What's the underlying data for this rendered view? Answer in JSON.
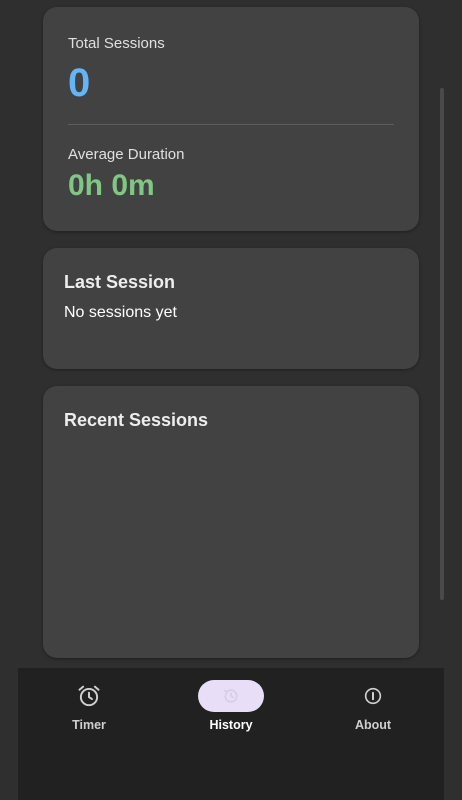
{
  "stats": {
    "total_label": "Total Sessions",
    "total_value": "0",
    "average_label": "Average Duration",
    "average_value": "0h 0m"
  },
  "last_session": {
    "title": "Last Session",
    "text": "No sessions yet"
  },
  "recent_sessions": {
    "title": "Recent Sessions"
  },
  "nav": {
    "items": [
      {
        "label": "Timer",
        "icon": "alarm-clock-icon"
      },
      {
        "label": "History",
        "icon": "history-icon",
        "active": true
      },
      {
        "label": "About",
        "icon": "info-icon"
      }
    ]
  },
  "colors": {
    "total_value": "#64b5f6",
    "average_value": "#81c784",
    "active_pill": "#e8def8",
    "background": "#2f2f2f",
    "card": "#424242",
    "nav_bar": "#212121"
  }
}
